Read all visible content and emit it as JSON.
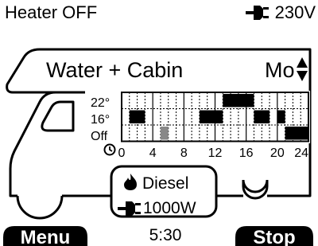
{
  "status": {
    "heater": "Heater OFF",
    "power_icon": "plug-icon",
    "voltage": "230V"
  },
  "mode": {
    "label": "Water + Cabin",
    "day": "Mo",
    "spinner_icon": "up-down-arrows-icon"
  },
  "schedule": {
    "levels": [
      "22°",
      "16°",
      "Off"
    ],
    "clock_icon": "clock-icon",
    "hour_ticks": [
      "0",
      "4",
      "8",
      "12",
      "16",
      "20",
      "24"
    ],
    "blocks": [
      {
        "level": "22°",
        "start": 13,
        "end": 17
      },
      {
        "level": "16°",
        "start": 1,
        "end": 3
      },
      {
        "level": "16°",
        "start": 10,
        "end": 13
      },
      {
        "level": "16°",
        "start": 17,
        "end": 19
      },
      {
        "level": "16°",
        "start": 20,
        "end": 21
      },
      {
        "level": "Off",
        "start": 5,
        "end": 6,
        "selected": true
      },
      {
        "level": "Off",
        "start": 21,
        "end": 24
      }
    ],
    "colors": {
      "filled": "#000000",
      "selected": "#888888",
      "grid": "#000000"
    }
  },
  "energy": {
    "fuel_icon": "flame-icon",
    "fuel": "Diesel",
    "power_icon": "plug-icon",
    "electric": "1000W"
  },
  "footer": {
    "menu_label": "Menu",
    "time": "5:30",
    "stop_label": "Stop"
  }
}
